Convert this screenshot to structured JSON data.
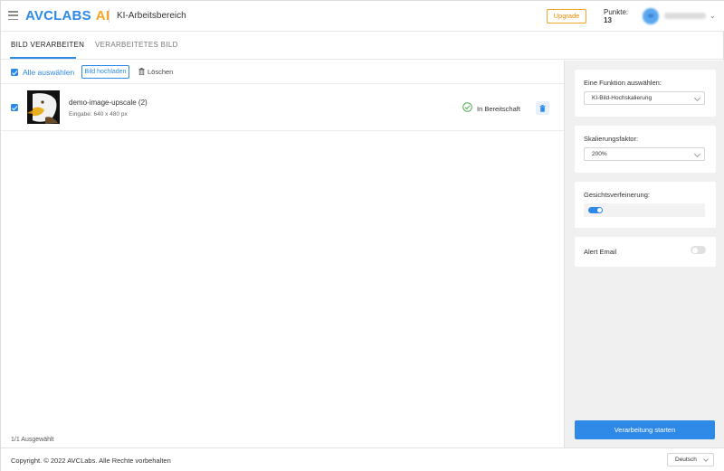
{
  "header": {
    "logo_main": "AVCLABS",
    "logo_accent": "AI",
    "workspace_title": "KI-Arbeitsbereich",
    "upgrade_label": "Upgrade",
    "points_label": "Punkte:",
    "points_value": "13",
    "icons": [
      "menu-icon",
      "user-avatar",
      "chevron-down-icon"
    ]
  },
  "tabs": [
    {
      "label": "BILD VERARBEITEN",
      "active": true
    },
    {
      "label": "VERARBEITETES BILD",
      "active": false
    }
  ],
  "toolbar": {
    "select_all_label": "Alle auswählen",
    "select_all_checked": true,
    "upload_label": "Bild hochladen",
    "delete_label": "Löschen"
  },
  "files": [
    {
      "name": "demo-image-upscale (2)",
      "meta": "Eingabe: 640 x 480 px",
      "status": "In Bereitschaft",
      "checked": true
    }
  ],
  "selection_summary": "1/1 Ausgewählt",
  "side_panel": {
    "function_label": "Eine Funktion auswählen:",
    "function_value": "KI-Bild-Hochskalierung",
    "scale_label": "Skalierungsfaktor:",
    "scale_value": "200%",
    "face_label": "Gesichtsverfeinerung:",
    "face_enabled": true,
    "alert_label": "Alert Email",
    "alert_enabled": false,
    "start_label": "Verarbeitung starten"
  },
  "footer": {
    "copyright": "Copyright. © 2022 AVCLabs. Alle Rechte vorbehalten",
    "language": "Deutsch"
  },
  "colors": {
    "accent": "#2e8ae6",
    "brand_orange": "#f5a623",
    "panel_bg": "#f0f0f0"
  }
}
